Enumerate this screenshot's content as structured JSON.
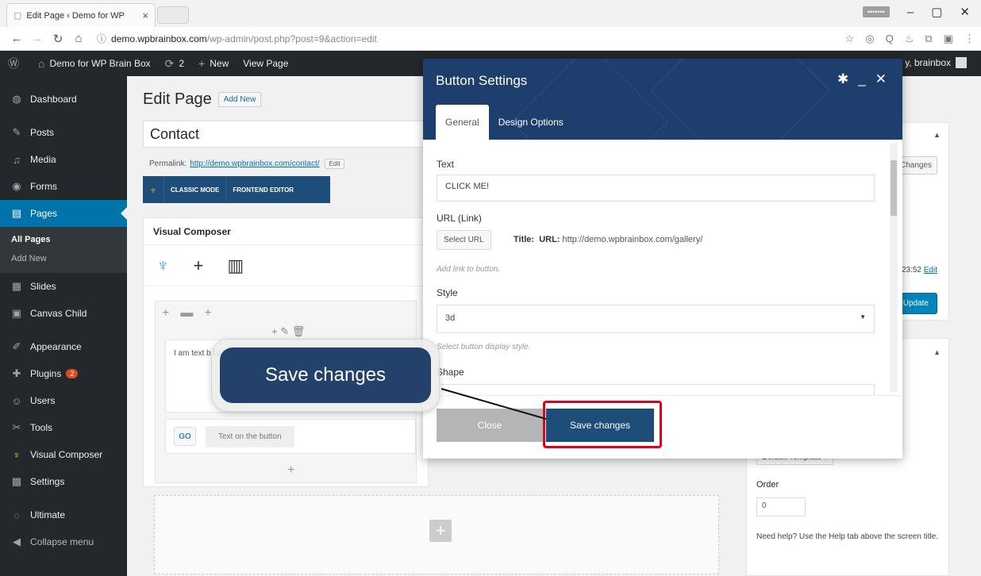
{
  "browser": {
    "tab_title": "Edit Page ‹ Demo for WP",
    "tab_close": "×",
    "window_badge": "•••••••",
    "url_host": "demo.wpbrainbox.com",
    "url_path": "/wp-admin/post.php?post=9&action=edit"
  },
  "adminbar": {
    "site_name": "Demo for WP Brain Box",
    "updates_count": "2",
    "new_label": "New",
    "view_page": "View Page",
    "howdy": "y, brainbox"
  },
  "sidebar": {
    "items": [
      {
        "label": "Dashboard",
        "icon": "dashboard-icon"
      },
      {
        "label": "Posts",
        "icon": "pin-icon"
      },
      {
        "label": "Media",
        "icon": "media-icon"
      },
      {
        "label": "Forms",
        "icon": "forms-icon"
      },
      {
        "label": "Pages",
        "icon": "pages-icon"
      }
    ],
    "pages_sub": [
      "All Pages",
      "Add New"
    ],
    "items2": [
      {
        "label": "Slides",
        "icon": "slides-icon"
      },
      {
        "label": "Canvas Child",
        "icon": "canvas-icon"
      },
      {
        "label": "Appearance",
        "icon": "brush-icon"
      },
      {
        "label": "Plugins",
        "icon": "plugin-icon",
        "badge": "2"
      },
      {
        "label": "Users",
        "icon": "users-icon"
      },
      {
        "label": "Tools",
        "icon": "wrench-icon"
      },
      {
        "label": "Visual Composer",
        "icon": "vc-icon"
      },
      {
        "label": "Settings",
        "icon": "settings-icon"
      },
      {
        "label": "Ultimate",
        "icon": "ultimate-icon"
      },
      {
        "label": "Collapse menu",
        "icon": "collapse-icon"
      }
    ]
  },
  "editor": {
    "page_title": "Edit Page",
    "add_new": "Add New",
    "post_title": "Contact",
    "permalink_label": "Permalink:",
    "permalink_url": "http://demo.wpbrainbox.com/contact/",
    "permalink_edit": "Edit",
    "classic_mode": "CLASSIC MODE",
    "frontend_editor": "FRONTEND EDITOR",
    "vc_heading": "Visual Composer",
    "text_block": "I am text b Lorem ipsu elit. Ut elit pulvinar d",
    "button_preview": "Text on the button",
    "go_icon": "GO"
  },
  "publish_box": {
    "preview_changes": "Changes",
    "published_time": "23:52",
    "published_edit": "Edit",
    "update": "Update"
  },
  "attributes_box": {
    "template": "Default Template",
    "order_label": "Order",
    "order_value": "0",
    "help": "Need help? Use the Help tab above the screen title."
  },
  "modal": {
    "title": "Button Settings",
    "tabs": [
      "General",
      "Design Options"
    ],
    "text_label": "Text",
    "text_value": "CLICK ME!",
    "url_label": "URL (Link)",
    "select_url": "Select URL",
    "title_label": "Title:",
    "url_info_label": "URL:",
    "url_info_value": "http://demo.wpbrainbox.com/gallery/",
    "url_hint": "Add link to button.",
    "style_label": "Style",
    "style_value": "3d",
    "style_hint": "Select button display style.",
    "shape_label": "Shape",
    "close": "Close",
    "save": "Save changes"
  },
  "callout": {
    "text": "Save changes"
  },
  "colors": {
    "accent": "#0073aa",
    "modal_header": "#1e3f6d",
    "save_button": "#1e4d79",
    "highlight": "#e0001b"
  }
}
